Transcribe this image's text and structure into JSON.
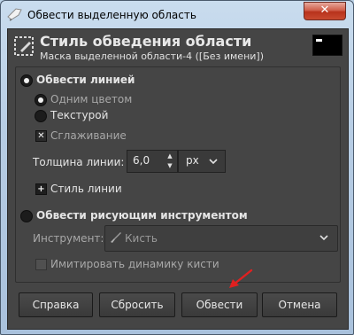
{
  "window": {
    "title": "Обвести выделенную область",
    "close_glyph": "✕"
  },
  "header": {
    "title": "Стиль обведения области",
    "subtitle": "Маска выделенной области-4 ([Без имени])",
    "icon": "stroke-selection-icon"
  },
  "stroke_line": {
    "label": "Обвести линией",
    "selected": true,
    "solid_color": {
      "label": "Одним цветом",
      "selected": true
    },
    "pattern": {
      "label": "Текстурой",
      "selected": false
    },
    "antialiasing": {
      "label": "Сглаживание",
      "checked": true
    },
    "line_width": {
      "label": "Толщина линии:",
      "value": "6,0",
      "unit": "px"
    },
    "line_style": {
      "label": "Стиль линии",
      "expander": "+"
    }
  },
  "stroke_paint": {
    "label": "Обвести рисующим инструментом",
    "selected": false,
    "tool": {
      "label": "Инструмент:",
      "value": "Кисть",
      "icon": "paintbrush-icon"
    },
    "emulate_dynamics": {
      "label": "Имитировать динамику кисти",
      "checked": false
    }
  },
  "buttons": {
    "help": "Справка",
    "reset": "Сбросить",
    "stroke": "Обвести",
    "cancel": "Отмена"
  },
  "colors": {
    "panel": "#454545",
    "text": "#e4e4e4",
    "disabled_text": "#a8a8a8",
    "annotation_arrow": "#e02020"
  }
}
